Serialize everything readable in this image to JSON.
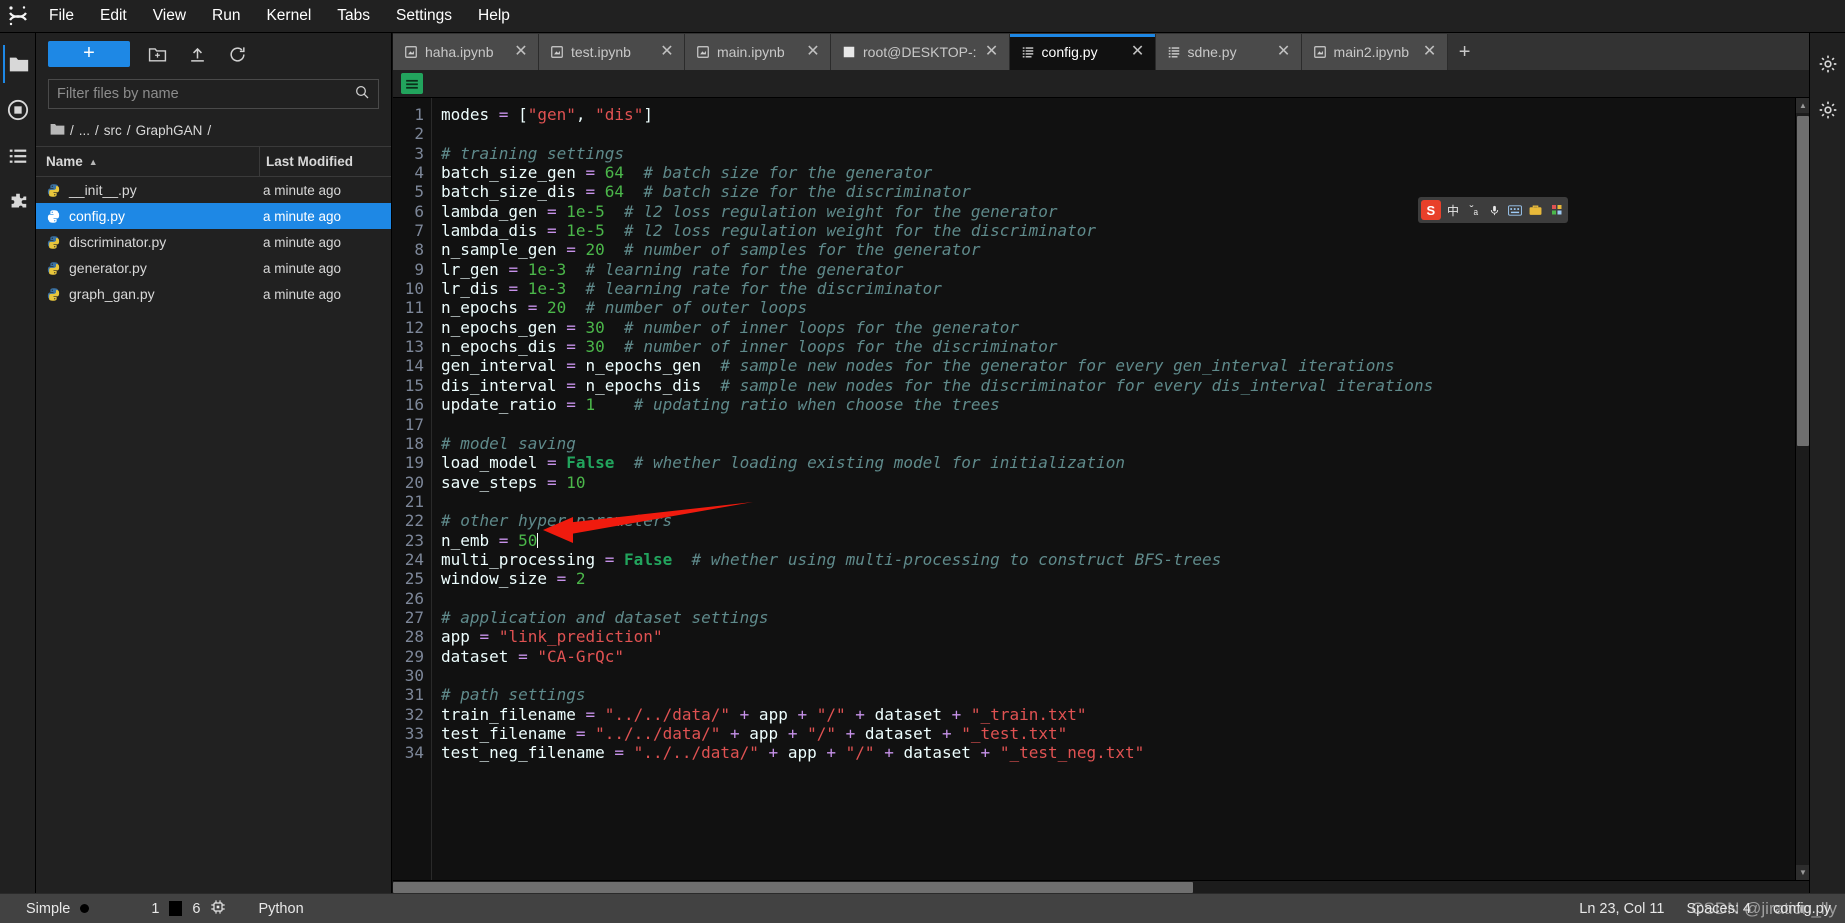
{
  "app": {
    "logo_icon": "jupyter-logo-icon",
    "menu_items": [
      "File",
      "Edit",
      "View",
      "Run",
      "Kernel",
      "Tabs",
      "Settings",
      "Help"
    ]
  },
  "left_rail": [
    {
      "name": "file-browser-icon",
      "glyph": "folder"
    },
    {
      "name": "running-terminals-icon",
      "glyph": "stop"
    },
    {
      "name": "commands-palette-icon",
      "glyph": "list"
    },
    {
      "name": "extension-manager-icon",
      "glyph": "puzzle"
    }
  ],
  "right_rail": [
    {
      "name": "property-inspector-icon",
      "glyph": "gear"
    },
    {
      "name": "debugger-icon",
      "glyph": "gear2"
    }
  ],
  "filebrowser": {
    "new_launcher_label": "+",
    "toolbar_icons": [
      "new-folder-icon",
      "upload-icon",
      "refresh-icon"
    ],
    "filter_placeholder": "Filter files by name",
    "filter_value": "",
    "search_icon": "search-icon",
    "breadcrumb": [
      "/",
      "...",
      "/",
      "src",
      "/",
      "GraphGAN",
      "/"
    ],
    "columns": {
      "name": "Name",
      "last_modified": "Last Modified"
    },
    "sort_caret": "▲",
    "files": [
      {
        "name": "__init__.py",
        "modified": "a minute ago",
        "selected": false
      },
      {
        "name": "config.py",
        "modified": "a minute ago",
        "selected": true
      },
      {
        "name": "discriminator.py",
        "modified": "a minute ago",
        "selected": false
      },
      {
        "name": "generator.py",
        "modified": "a minute ago",
        "selected": false
      },
      {
        "name": "graph_gan.py",
        "modified": "a minute ago",
        "selected": false
      }
    ]
  },
  "tabs": [
    {
      "label": "haha.ipynb",
      "icon": "notebook-icon",
      "active": false,
      "closable": true
    },
    {
      "label": "test.ipynb",
      "icon": "notebook-icon",
      "active": false,
      "closable": true
    },
    {
      "label": "main.ipynb",
      "icon": "notebook-icon",
      "active": false,
      "closable": true
    },
    {
      "label": "root@DESKTOP-:",
      "icon": "terminal-icon",
      "active": false,
      "closable": true
    },
    {
      "label": "config.py",
      "icon": "text-file-icon",
      "active": true,
      "closable": true
    },
    {
      "label": "sdne.py",
      "icon": "text-file-icon",
      "active": false,
      "closable": true
    },
    {
      "label": "main2.ipynb",
      "icon": "notebook-icon",
      "active": false,
      "closable": true
    }
  ],
  "tab_add_label": "+",
  "editor": {
    "save_icon": "save-icon",
    "lines": [
      {
        "n": 1,
        "tokens": [
          {
            "t": "modes ",
            "c": "var"
          },
          {
            "t": "=",
            "c": "op"
          },
          {
            "t": " ",
            "c": "var"
          },
          {
            "t": "[",
            "c": "br"
          },
          {
            "t": "\"gen\"",
            "c": "str"
          },
          {
            "t": ", ",
            "c": "br"
          },
          {
            "t": "\"dis\"",
            "c": "str"
          },
          {
            "t": "]",
            "c": "br"
          }
        ]
      },
      {
        "n": 2,
        "tokens": []
      },
      {
        "n": 3,
        "tokens": [
          {
            "t": "# training settings",
            "c": "cmt"
          }
        ]
      },
      {
        "n": 4,
        "tokens": [
          {
            "t": "batch_size_gen ",
            "c": "var"
          },
          {
            "t": "=",
            "c": "op"
          },
          {
            "t": " ",
            "c": "var"
          },
          {
            "t": "64",
            "c": "num"
          },
          {
            "t": "  ",
            "c": "var"
          },
          {
            "t": "# batch size for the generator",
            "c": "cmt"
          }
        ]
      },
      {
        "n": 5,
        "tokens": [
          {
            "t": "batch_size_dis ",
            "c": "var"
          },
          {
            "t": "=",
            "c": "op"
          },
          {
            "t": " ",
            "c": "var"
          },
          {
            "t": "64",
            "c": "num"
          },
          {
            "t": "  ",
            "c": "var"
          },
          {
            "t": "# batch size for the discriminator",
            "c": "cmt"
          }
        ]
      },
      {
        "n": 6,
        "tokens": [
          {
            "t": "lambda_gen ",
            "c": "var"
          },
          {
            "t": "=",
            "c": "op"
          },
          {
            "t": " ",
            "c": "var"
          },
          {
            "t": "1e-5",
            "c": "num"
          },
          {
            "t": "  ",
            "c": "var"
          },
          {
            "t": "# l2 loss regulation weight for the generator",
            "c": "cmt"
          }
        ]
      },
      {
        "n": 7,
        "tokens": [
          {
            "t": "lambda_dis ",
            "c": "var"
          },
          {
            "t": "=",
            "c": "op"
          },
          {
            "t": " ",
            "c": "var"
          },
          {
            "t": "1e-5",
            "c": "num"
          },
          {
            "t": "  ",
            "c": "var"
          },
          {
            "t": "# l2 loss regulation weight for the discriminator",
            "c": "cmt"
          }
        ]
      },
      {
        "n": 8,
        "tokens": [
          {
            "t": "n_sample_gen ",
            "c": "var"
          },
          {
            "t": "=",
            "c": "op"
          },
          {
            "t": " ",
            "c": "var"
          },
          {
            "t": "20",
            "c": "num"
          },
          {
            "t": "  ",
            "c": "var"
          },
          {
            "t": "# number of samples for the generator",
            "c": "cmt"
          }
        ]
      },
      {
        "n": 9,
        "tokens": [
          {
            "t": "lr_gen ",
            "c": "var"
          },
          {
            "t": "=",
            "c": "op"
          },
          {
            "t": " ",
            "c": "var"
          },
          {
            "t": "1e-3",
            "c": "num"
          },
          {
            "t": "  ",
            "c": "var"
          },
          {
            "t": "# learning rate for the generator",
            "c": "cmt"
          }
        ]
      },
      {
        "n": 10,
        "tokens": [
          {
            "t": "lr_dis ",
            "c": "var"
          },
          {
            "t": "=",
            "c": "op"
          },
          {
            "t": " ",
            "c": "var"
          },
          {
            "t": "1e-3",
            "c": "num"
          },
          {
            "t": "  ",
            "c": "var"
          },
          {
            "t": "# learning rate for the discriminator",
            "c": "cmt"
          }
        ]
      },
      {
        "n": 11,
        "tokens": [
          {
            "t": "n_epochs ",
            "c": "var"
          },
          {
            "t": "=",
            "c": "op"
          },
          {
            "t": " ",
            "c": "var"
          },
          {
            "t": "20",
            "c": "num"
          },
          {
            "t": "  ",
            "c": "var"
          },
          {
            "t": "# number of outer loops",
            "c": "cmt"
          }
        ]
      },
      {
        "n": 12,
        "tokens": [
          {
            "t": "n_epochs_gen ",
            "c": "var"
          },
          {
            "t": "=",
            "c": "op"
          },
          {
            "t": " ",
            "c": "var"
          },
          {
            "t": "30",
            "c": "num"
          },
          {
            "t": "  ",
            "c": "var"
          },
          {
            "t": "# number of inner loops for the generator",
            "c": "cmt"
          }
        ]
      },
      {
        "n": 13,
        "tokens": [
          {
            "t": "n_epochs_dis ",
            "c": "var"
          },
          {
            "t": "=",
            "c": "op"
          },
          {
            "t": " ",
            "c": "var"
          },
          {
            "t": "30",
            "c": "num"
          },
          {
            "t": "  ",
            "c": "var"
          },
          {
            "t": "# number of inner loops for the discriminator",
            "c": "cmt"
          }
        ]
      },
      {
        "n": 14,
        "tokens": [
          {
            "t": "gen_interval ",
            "c": "var"
          },
          {
            "t": "=",
            "c": "op"
          },
          {
            "t": " n_epochs_gen",
            "c": "var"
          },
          {
            "t": "  ",
            "c": "var"
          },
          {
            "t": "# sample new nodes for the generator for every gen_interval iterations",
            "c": "cmt"
          }
        ]
      },
      {
        "n": 15,
        "tokens": [
          {
            "t": "dis_interval ",
            "c": "var"
          },
          {
            "t": "=",
            "c": "op"
          },
          {
            "t": " n_epochs_dis",
            "c": "var"
          },
          {
            "t": "  ",
            "c": "var"
          },
          {
            "t": "# sample new nodes for the discriminator for every dis_interval iterations",
            "c": "cmt"
          }
        ]
      },
      {
        "n": 16,
        "tokens": [
          {
            "t": "update_ratio ",
            "c": "var"
          },
          {
            "t": "=",
            "c": "op"
          },
          {
            "t": " ",
            "c": "var"
          },
          {
            "t": "1",
            "c": "num"
          },
          {
            "t": "    ",
            "c": "var"
          },
          {
            "t": "# updating ratio when choose the trees",
            "c": "cmt"
          }
        ]
      },
      {
        "n": 17,
        "tokens": []
      },
      {
        "n": 18,
        "tokens": [
          {
            "t": "# model saving",
            "c": "cmt"
          }
        ]
      },
      {
        "n": 19,
        "tokens": [
          {
            "t": "load_model ",
            "c": "var"
          },
          {
            "t": "=",
            "c": "op"
          },
          {
            "t": " ",
            "c": "var"
          },
          {
            "t": "False",
            "c": "kw"
          },
          {
            "t": "  ",
            "c": "var"
          },
          {
            "t": "# whether loading existing model for initialization",
            "c": "cmt"
          }
        ]
      },
      {
        "n": 20,
        "tokens": [
          {
            "t": "save_steps ",
            "c": "var"
          },
          {
            "t": "=",
            "c": "op"
          },
          {
            "t": " ",
            "c": "var"
          },
          {
            "t": "10",
            "c": "num"
          }
        ]
      },
      {
        "n": 21,
        "tokens": []
      },
      {
        "n": 22,
        "tokens": [
          {
            "t": "# other hyper-parameters",
            "c": "cmt"
          }
        ]
      },
      {
        "n": 23,
        "tokens": [
          {
            "t": "n_emb ",
            "c": "var"
          },
          {
            "t": "=",
            "c": "op"
          },
          {
            "t": " ",
            "c": "var"
          },
          {
            "t": "50",
            "c": "num"
          }
        ],
        "cursor_after": true
      },
      {
        "n": 24,
        "tokens": [
          {
            "t": "multi_processing ",
            "c": "var"
          },
          {
            "t": "=",
            "c": "op"
          },
          {
            "t": " ",
            "c": "var"
          },
          {
            "t": "False",
            "c": "kw"
          },
          {
            "t": "  ",
            "c": "var"
          },
          {
            "t": "# whether using multi-processing to construct BFS-trees",
            "c": "cmt"
          }
        ]
      },
      {
        "n": 25,
        "tokens": [
          {
            "t": "window_size ",
            "c": "var"
          },
          {
            "t": "=",
            "c": "op"
          },
          {
            "t": " ",
            "c": "var"
          },
          {
            "t": "2",
            "c": "num"
          }
        ]
      },
      {
        "n": 26,
        "tokens": []
      },
      {
        "n": 27,
        "tokens": [
          {
            "t": "# application and dataset settings",
            "c": "cmt"
          }
        ]
      },
      {
        "n": 28,
        "tokens": [
          {
            "t": "app ",
            "c": "var"
          },
          {
            "t": "=",
            "c": "op"
          },
          {
            "t": " ",
            "c": "var"
          },
          {
            "t": "\"link_prediction\"",
            "c": "str"
          }
        ]
      },
      {
        "n": 29,
        "tokens": [
          {
            "t": "dataset ",
            "c": "var"
          },
          {
            "t": "=",
            "c": "op"
          },
          {
            "t": " ",
            "c": "var"
          },
          {
            "t": "\"CA-GrQc\"",
            "c": "str"
          }
        ]
      },
      {
        "n": 30,
        "tokens": []
      },
      {
        "n": 31,
        "tokens": [
          {
            "t": "# path settings",
            "c": "cmt"
          }
        ]
      },
      {
        "n": 32,
        "tokens": [
          {
            "t": "train_filename ",
            "c": "var"
          },
          {
            "t": "=",
            "c": "op"
          },
          {
            "t": " ",
            "c": "var"
          },
          {
            "t": "\"../../data/\"",
            "c": "str"
          },
          {
            "t": " ",
            "c": "var"
          },
          {
            "t": "+",
            "c": "op"
          },
          {
            "t": " app ",
            "c": "var"
          },
          {
            "t": "+",
            "c": "op"
          },
          {
            "t": " ",
            "c": "var"
          },
          {
            "t": "\"/\"",
            "c": "str"
          },
          {
            "t": " ",
            "c": "var"
          },
          {
            "t": "+",
            "c": "op"
          },
          {
            "t": " dataset ",
            "c": "var"
          },
          {
            "t": "+",
            "c": "op"
          },
          {
            "t": " ",
            "c": "var"
          },
          {
            "t": "\"_train.txt\"",
            "c": "str"
          }
        ]
      },
      {
        "n": 33,
        "tokens": [
          {
            "t": "test_filename ",
            "c": "var"
          },
          {
            "t": "=",
            "c": "op"
          },
          {
            "t": " ",
            "c": "var"
          },
          {
            "t": "\"../../data/\"",
            "c": "str"
          },
          {
            "t": " ",
            "c": "var"
          },
          {
            "t": "+",
            "c": "op"
          },
          {
            "t": " app ",
            "c": "var"
          },
          {
            "t": "+",
            "c": "op"
          },
          {
            "t": " ",
            "c": "var"
          },
          {
            "t": "\"/\"",
            "c": "str"
          },
          {
            "t": " ",
            "c": "var"
          },
          {
            "t": "+",
            "c": "op"
          },
          {
            "t": " dataset ",
            "c": "var"
          },
          {
            "t": "+",
            "c": "op"
          },
          {
            "t": " ",
            "c": "var"
          },
          {
            "t": "\"_test.txt\"",
            "c": "str"
          }
        ]
      },
      {
        "n": 34,
        "tokens": [
          {
            "t": "test_neg_filename ",
            "c": "var"
          },
          {
            "t": "=",
            "c": "op"
          },
          {
            "t": " ",
            "c": "var"
          },
          {
            "t": "\"../../data/\"",
            "c": "str"
          },
          {
            "t": " ",
            "c": "var"
          },
          {
            "t": "+",
            "c": "op"
          },
          {
            "t": " app ",
            "c": "var"
          },
          {
            "t": "+",
            "c": "op"
          },
          {
            "t": " ",
            "c": "var"
          },
          {
            "t": "\"/\"",
            "c": "str"
          },
          {
            "t": " ",
            "c": "var"
          },
          {
            "t": "+",
            "c": "op"
          },
          {
            "t": " dataset ",
            "c": "var"
          },
          {
            "t": "+",
            "c": "op"
          },
          {
            "t": " ",
            "c": "var"
          },
          {
            "t": "\"_test_neg.txt\"",
            "c": "str"
          }
        ]
      }
    ]
  },
  "annotation": {
    "type": "red-arrow",
    "color": "#f01b0e",
    "points_at_line": 23
  },
  "ime": {
    "logo_label": "S",
    "buttons": [
      "中",
      "ˇₐ",
      "mic-icon",
      "keyboard-icon",
      "toolbox-icon",
      "grid-icon"
    ]
  },
  "statusbar": {
    "mode_label": "Simple",
    "kernel_dot": "kernel-idle-indicator",
    "terminal_count": "1",
    "kernel_count": "6",
    "kernel_icon": "cpu-icon",
    "language": "Python",
    "cursor_position": "Ln 23, Col 11",
    "spaces": "Spaces: 4",
    "filename": "config.py"
  },
  "watermark": "CSDN @jiration_lly",
  "colors": {
    "accent": "#1e88e5",
    "save_green": "#22a45d",
    "annotation_red": "#f01b0e",
    "comment": "#5f8a8b",
    "string": "#e05252",
    "number": "#4bb74a",
    "operator": "#c792ea"
  }
}
